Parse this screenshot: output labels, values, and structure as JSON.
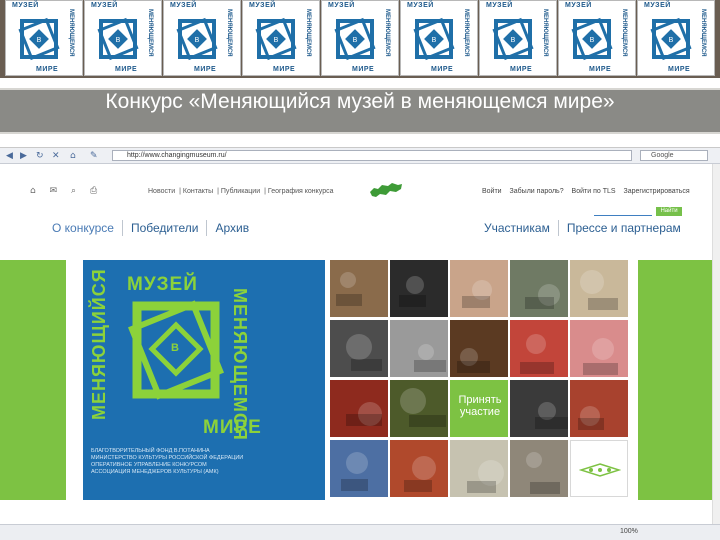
{
  "logo_strip": {
    "tile_top_text": "МУЗЕЙ",
    "tile_bottom_text": "МИРЕ",
    "tile_side_text": "МЕНЯЮЩЕМСЯ",
    "tile_center": "В"
  },
  "slide": {
    "title": "Конкурс «Меняющийся музей в меняющемся мире»"
  },
  "browser": {
    "address": "http://www.changingmuseum.ru/",
    "search_engine": "Google",
    "zoom": "100%"
  },
  "site": {
    "top_menu": [
      "Новости",
      "Контакты",
      "Публикации",
      "География конкурса"
    ],
    "login_links": [
      "Войти",
      "Забыли пароль?",
      "Войти по TLS",
      "Зарегистрироваться"
    ],
    "search_button": "Найти",
    "main_tabs": [
      "О конкурсе",
      "Победители",
      "Архив"
    ],
    "right_tabs": [
      "Участникам",
      "Прессе и партнерам"
    ],
    "logo_words": {
      "top": "МУЗЕЙ",
      "left": "МЕНЯЮЩИЙСЯ",
      "right": "МЕНЯЮЩЕМСЯ",
      "bottom": "МИРЕ",
      "center": "В"
    },
    "info_lines": [
      "БЛАГОТВОРИТЕЛЬНЫЙ ФОНД В.ПОТАНИНА",
      "МИНИСТЕРСТВО КУЛЬТУРЫ РОССИЙСКОЙ ФЕДЕРАЦИИ",
      "ОПЕРАТИВНОЕ УПРАВЛЕНИЕ КОНКУРСОМ",
      "АССОЦИАЦИЯ МЕНЕДЖЕРОВ КУЛЬТУРЫ (АМК)"
    ],
    "cta": "Принять участие"
  },
  "colors": {
    "brand_green": "#7dc243",
    "brand_blue": "#1d6fb0",
    "title_bar": "#8a8a86",
    "strip_bg": "#6a5e52"
  }
}
